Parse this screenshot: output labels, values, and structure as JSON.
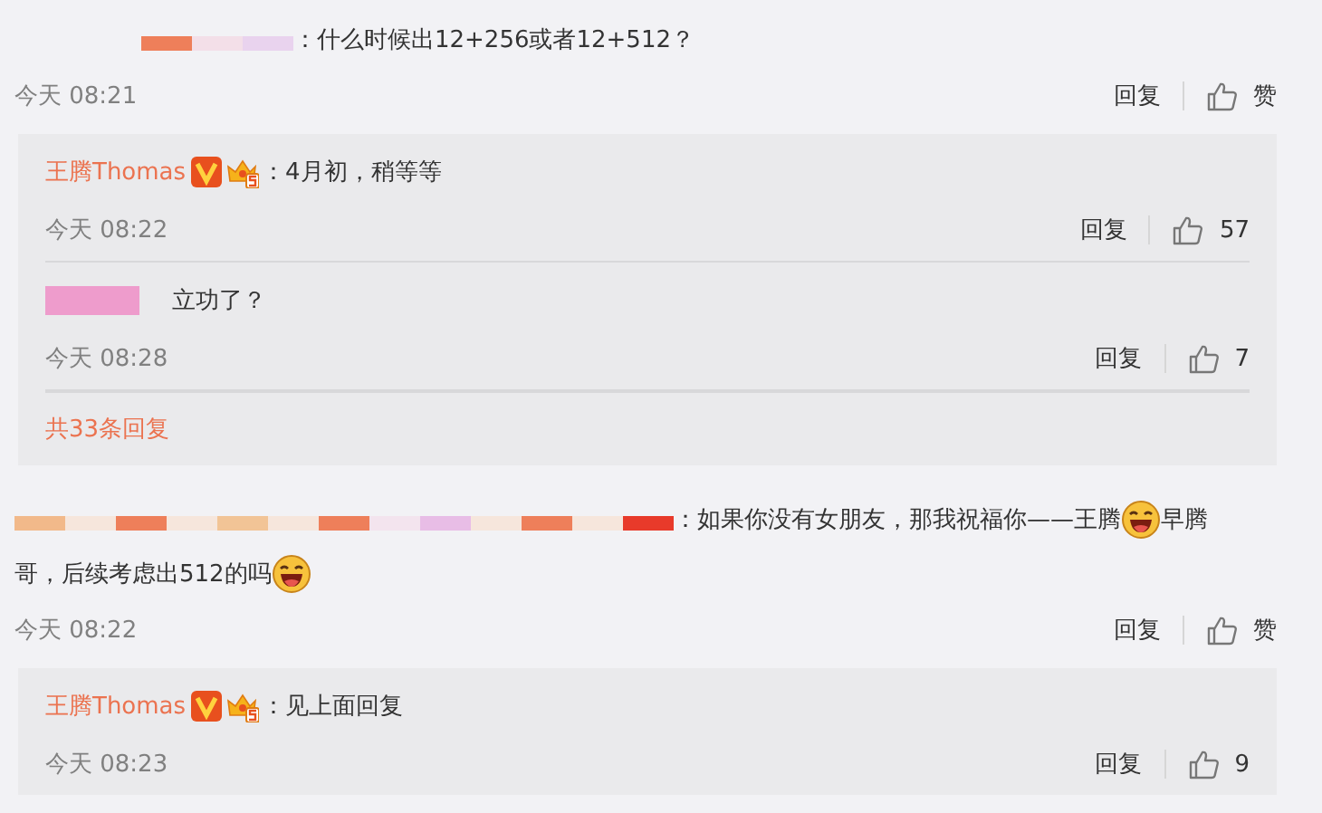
{
  "comments": [
    {
      "author": {
        "kind": "redacted"
      },
      "body": [
        {
          "kind": "text",
          "text": "：什么时候出12+256或者12+512？"
        }
      ],
      "time": "今天 08:21",
      "reply_label": "回复",
      "like": "赞",
      "replies": {
        "items": [
          {
            "author": {
              "kind": "name",
              "name": "王腾Thomas",
              "verified": true,
              "crown": true
            },
            "text": "：4月初，稍等等",
            "time": "今天 08:22",
            "reply_label": "回复",
            "like": "57"
          },
          {
            "author": {
              "kind": "redacted"
            },
            "text": "立功了？",
            "time": "今天 08:28",
            "reply_label": "回复",
            "like": "7"
          }
        ],
        "more": "共33条回复"
      }
    },
    {
      "author": {
        "kind": "redacted"
      },
      "body": [
        {
          "kind": "text",
          "text": "：如果你没有女朋友，那我祝福你——王腾"
        },
        {
          "kind": "emoji"
        },
        {
          "kind": "text",
          "text": "早腾"
        },
        {
          "kind": "text",
          "text": "哥，后续考虑出512的吗"
        },
        {
          "kind": "emoji"
        }
      ],
      "time": "今天 08:22",
      "reply_label": "回复",
      "like": "赞",
      "replies": {
        "items": [
          {
            "author": {
              "kind": "name",
              "name": "王腾Thomas",
              "verified": true,
              "crown": true
            },
            "text": "：见上面回复",
            "time": "今天 08:23",
            "reply_label": "回复",
            "like": "9"
          }
        ]
      }
    }
  ]
}
